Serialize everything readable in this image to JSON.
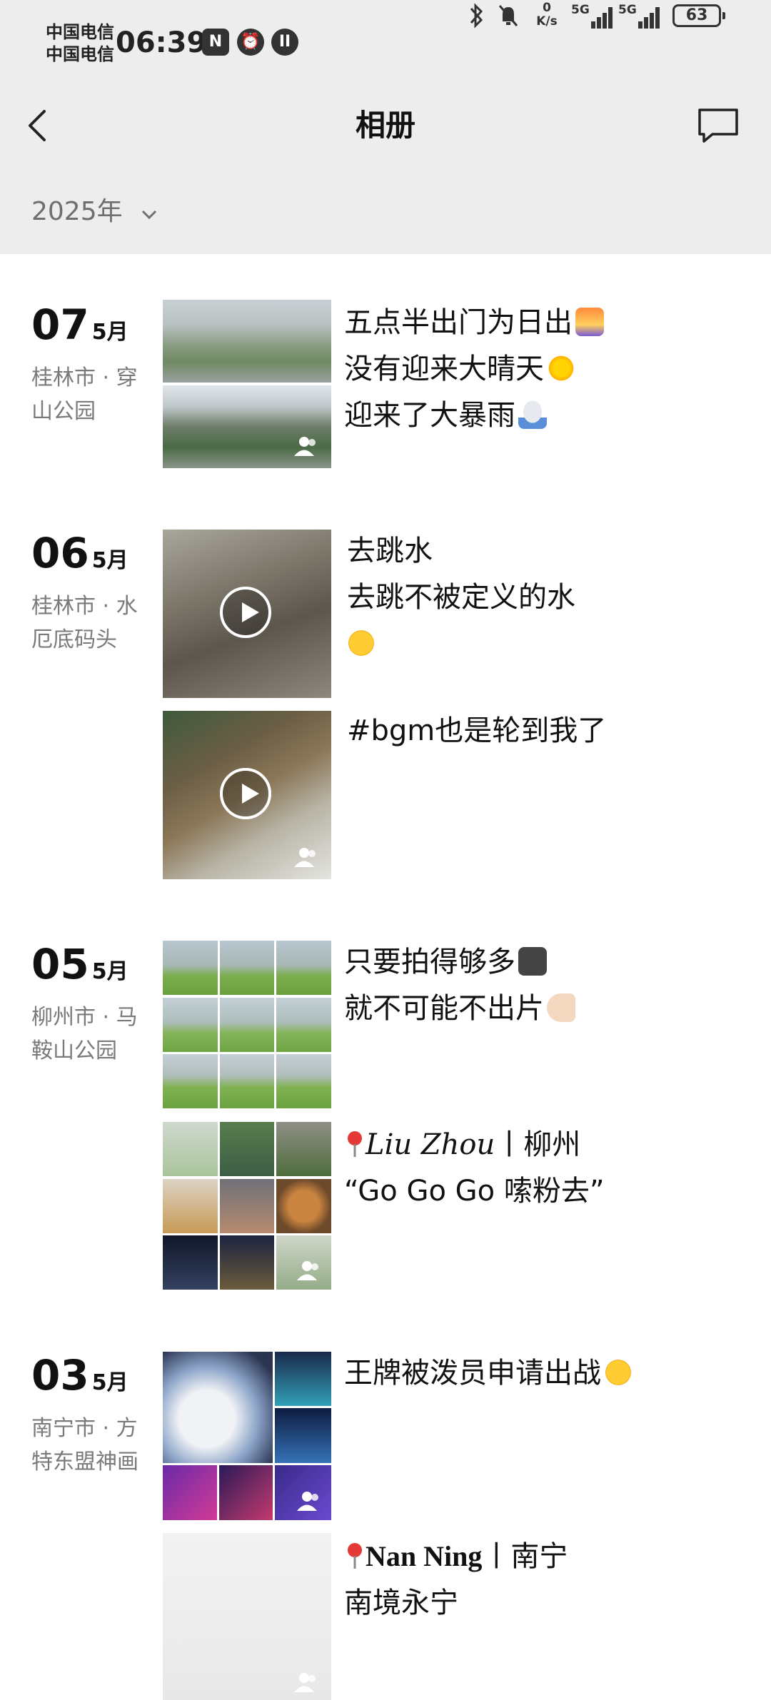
{
  "status_bar": {
    "carrier_1": "中国电信",
    "carrier_2": "中国电信",
    "time": "06:39",
    "speed_value": "0",
    "speed_unit": "K/s",
    "network_1": "5G",
    "network_2": "5G",
    "battery": "63"
  },
  "nav": {
    "title": "相册"
  },
  "year_selector": {
    "label": "2025年"
  },
  "posts": [
    {
      "day": "07",
      "month": "5月",
      "location": "桂林市 · 穿山公园",
      "lines": [
        "五点半出门为日出",
        "没有迎来大晴天",
        "迎来了大暴雨"
      ]
    },
    {
      "day": "06",
      "month": "5月",
      "location": "桂林市 · 水厄底码头",
      "lines": [
        "去跳水",
        "去跳不被定义的水"
      ],
      "second_caption": "#bgm也是轮到我了"
    },
    {
      "day": "05",
      "month": "5月",
      "location": "柳州市 · 马鞍山公园",
      "lines": [
        "只要拍得够多",
        "就不可能不出片"
      ],
      "second_caption_1": "Liu Zhou",
      "second_caption_1b": "丨柳州",
      "second_caption_2": "“Go Go Go 嗦粉去”"
    },
    {
      "day": "03",
      "month": "5月",
      "location": "南宁市 · 方特东盟神画",
      "lines": [
        "王牌被泼员申请出战"
      ],
      "second_caption_1": "Nan Ning",
      "second_caption_1b": "丨南宁",
      "second_caption_2": "南境永宁"
    }
  ],
  "colors": {
    "header_bg": "#ededed",
    "text_primary": "#111111",
    "text_secondary": "#7a7a7a"
  },
  "icons": [
    "back-arrow-icon",
    "message-icon",
    "chevron-down-icon",
    "play-icon",
    "person-icon",
    "location-pin-icon"
  ]
}
